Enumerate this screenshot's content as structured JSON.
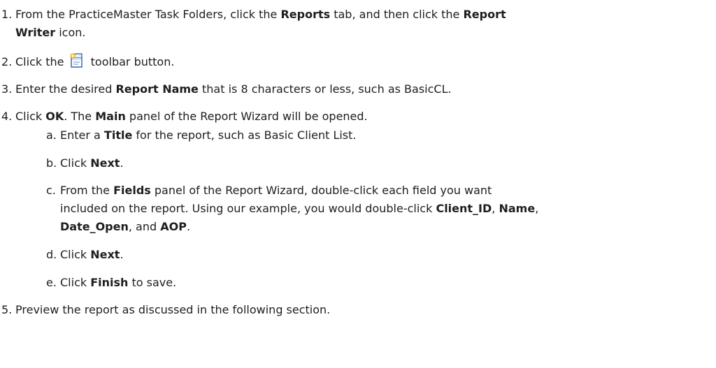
{
  "steps": [
    {
      "num": "1.",
      "line1": {
        "pre": "From the PracticeMaster Task Folders, click the ",
        "b1": "Reports",
        "mid": " tab, and then click the ",
        "b2": "Report"
      },
      "line2": {
        "b": "Writer",
        "post": " icon."
      }
    },
    {
      "num": "2.",
      "pre": "Click the ",
      "post": " toolbar button.",
      "icon": "new-report-icon"
    },
    {
      "num": "3.",
      "pre": "Enter the desired ",
      "b": "Report Name",
      "post": " that is 8 characters or less, such as BasicCL."
    },
    {
      "num": "4.",
      "pre": "Click ",
      "b1": "OK",
      "mid": ". The ",
      "b2": "Main",
      "post": " panel of the Report Wizard will be opened."
    },
    {
      "num": "5.",
      "text": "Preview the report as discussed in the following section."
    }
  ],
  "substeps": [
    {
      "letter": "a.",
      "pre": "Enter a ",
      "b": "Title",
      "post": " for the report, such as Basic Client List."
    },
    {
      "letter": "b.",
      "pre": "Click ",
      "b": "Next",
      "post": "."
    },
    {
      "letter": "c.",
      "line1": {
        "pre": "From the ",
        "b": "Fields",
        "post": " panel of the Report Wizard, double-click each field you want"
      },
      "line2": {
        "pre": "included on the report. Using our example, you would double-click ",
        "b1": "Client_ID",
        "mid": ", ",
        "b2": "Name",
        "post": ","
      },
      "line3": {
        "b1": "Date_Open",
        "mid": ", and ",
        "b2": "AOP",
        "post": "."
      }
    },
    {
      "letter": "d.",
      "pre": "Click ",
      "b": "Next",
      "post": "."
    },
    {
      "letter": "e.",
      "pre": "Click ",
      "b": "Finish",
      "post": " to save."
    }
  ]
}
